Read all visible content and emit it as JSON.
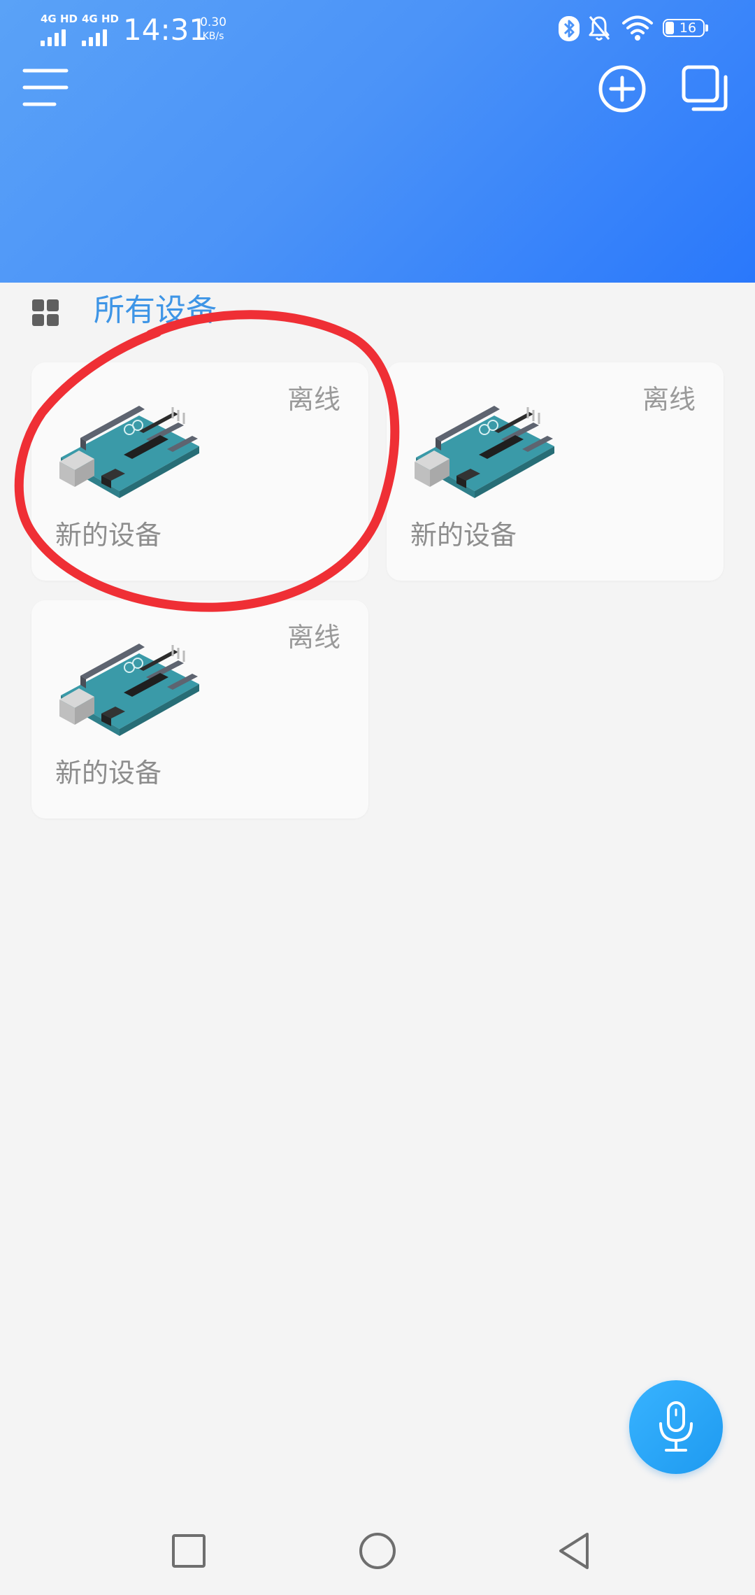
{
  "status_bar": {
    "sim1": "4G HD",
    "sim2": "4G HD",
    "time": "14:31",
    "speed_value": "0.30",
    "speed_unit": "KB/s",
    "battery": "16"
  },
  "header": {
    "menu_icon": "hamburger-menu-icon",
    "add_icon": "add-circle-icon",
    "multi_icon": "stacked-windows-icon"
  },
  "section": {
    "title": "所有设备",
    "icon": "grid-view-icon"
  },
  "devices": [
    {
      "name": "新的设备",
      "status": "离线"
    },
    {
      "name": "新的设备",
      "status": "离线"
    },
    {
      "name": "新的设备",
      "status": "离线"
    }
  ],
  "colors": {
    "header_start": "#5aa2f7",
    "header_end": "#2a78fb",
    "accent": "#3e95e6",
    "annotation": "#ef2f35",
    "fab": "#1e9af0"
  },
  "fab": {
    "icon": "microphone-icon"
  },
  "navigation": {
    "recent": "square-icon",
    "home": "circle-icon",
    "back": "triangle-back-icon"
  }
}
